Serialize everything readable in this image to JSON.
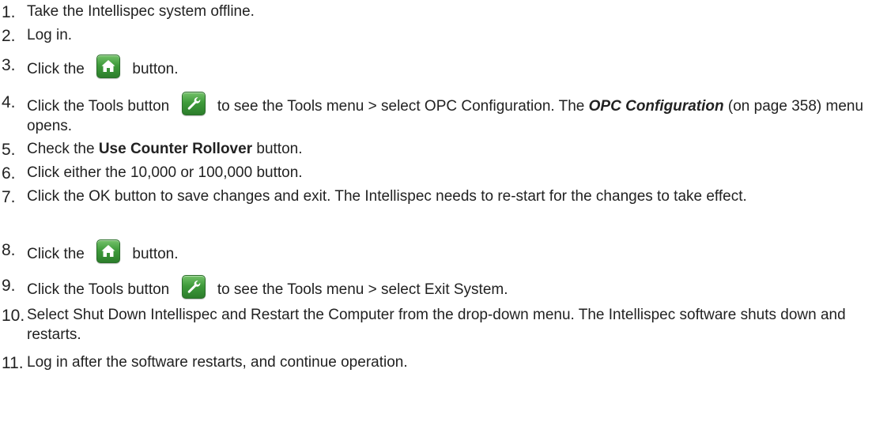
{
  "steps": [
    {
      "number": "1.",
      "text": "Take the Intellispec system offline."
    },
    {
      "number": "2.",
      "text": "Log in."
    },
    {
      "number": "3.",
      "before": "Click the",
      "icon": "home-icon",
      "after": "button."
    },
    {
      "number": "4.",
      "before": "Click the Tools button",
      "icon": "wrench-icon",
      "after": "to see the Tools menu > select OPC Configuration. The",
      "link_text": "OPC Configuration",
      "after_link": "(on page 358) menu opens."
    },
    {
      "number": "5.",
      "before": "Check the",
      "bold": "Use Counter Rollover",
      "after": "button."
    },
    {
      "number": "6.",
      "text": "Click either the 10,000 or 100,000 button."
    },
    {
      "number": "7.",
      "text": "Click the OK button to save changes and exit. The Intellispec needs to re-start for the changes to take effect."
    },
    {
      "number": "8.",
      "before": "Click the",
      "icon": "home-icon",
      "after": "button."
    },
    {
      "number": "9.",
      "before": "Click the Tools button",
      "icon": "wrench-icon",
      "after": "to see the Tools menu > select Exit System."
    },
    {
      "number": "10.",
      "text": "Select Shut Down Intellispec and Restart the Computer from the drop-down menu. The Intellispec software shuts down and restarts."
    },
    {
      "number": "11.",
      "text": "Log in after the software restarts, and continue operation."
    }
  ],
  "colors": {
    "text": "#222222",
    "icon_green": "#3f9b3b"
  }
}
